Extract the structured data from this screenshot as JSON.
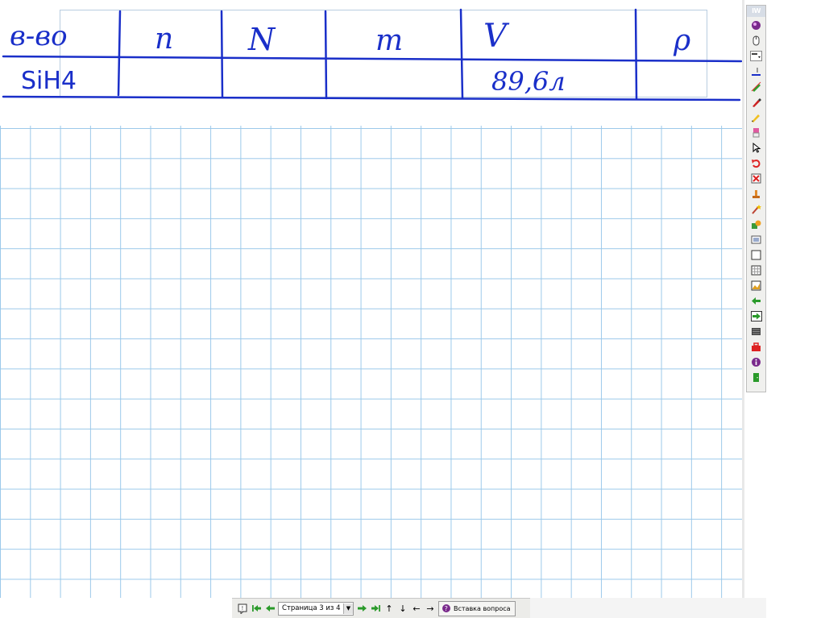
{
  "table": {
    "headers": [
      "в-во",
      "n",
      "N",
      "m",
      "V",
      "ρ"
    ],
    "row": [
      "SiH4",
      "",
      "",
      "",
      "89,6л",
      ""
    ]
  },
  "toolbar": {
    "badge": "IW",
    "tools": [
      "globe-icon",
      "mouse-icon",
      "line-style-icon",
      "pen-width-icon",
      "highlighter-icon",
      "marker-icon",
      "pencil-icon",
      "eraser-icon",
      "cursor-icon",
      "undo-icon",
      "delete-icon",
      "stamp-icon",
      "magic-pen-icon",
      "shapes-icon",
      "screenshot-icon",
      "blank-page-icon",
      "grid-page-icon",
      "image-page-icon",
      "prev-page-icon",
      "next-page-icon",
      "keyboard-icon",
      "toolbox-icon",
      "info-icon",
      "exit-icon"
    ]
  },
  "statusbar": {
    "page_label": "Страница 3 из 4",
    "insert_label": "Вставка вопроса"
  },
  "colors": {
    "ink": "#1a2fc9",
    "grid": "#9cc9ea"
  }
}
